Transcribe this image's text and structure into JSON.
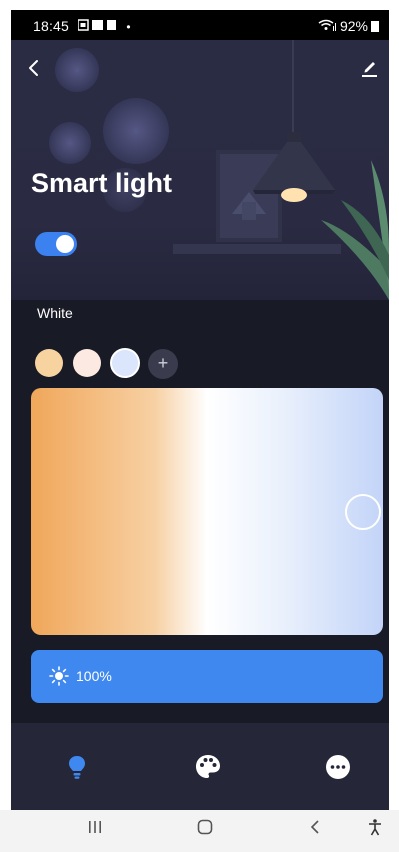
{
  "status_bar": {
    "time": "18:45",
    "battery": "92%"
  },
  "header": {
    "title": "Smart light",
    "power_on": true
  },
  "color_section": {
    "label": "White",
    "presets": [
      {
        "color": "#f7d3a0",
        "selected": false
      },
      {
        "color": "#fbe9e2",
        "selected": false
      },
      {
        "color": "#dbe5fb",
        "selected": true
      }
    ],
    "add_label": "+"
  },
  "brightness": {
    "value": "100%"
  },
  "colors": {
    "accent": "#3e88f0",
    "background": "#181a26",
    "hero": "#2a2c44"
  },
  "bottom_tabs": [
    {
      "icon": "bulb-icon",
      "active": true
    },
    {
      "icon": "palette-icon",
      "active": false
    },
    {
      "icon": "more-icon",
      "active": false
    }
  ]
}
